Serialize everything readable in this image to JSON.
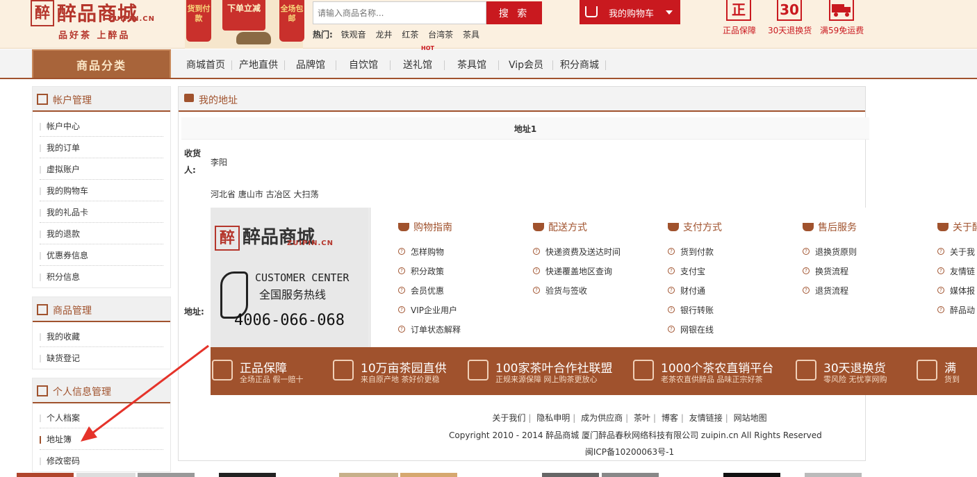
{
  "header": {
    "logo": {
      "seal": "醉",
      "name": "醉品商城",
      "domain": "ZUIPIN.CN",
      "slogan": "品好茶 上醉品"
    },
    "promo": {
      "left_lantern": "货到付款",
      "banner": "下单立减",
      "right_lantern": "全场包邮"
    },
    "search": {
      "placeholder": "请输入商品名称...",
      "button": "搜 索"
    },
    "hot": {
      "label": "热门:",
      "items": [
        "铁观音",
        "龙井",
        "红茶",
        "台湾茶",
        "茶具"
      ]
    },
    "cart": {
      "label": "我的购物车"
    },
    "guarantees": [
      {
        "icon": "正",
        "label": "正品保障"
      },
      {
        "icon": "30",
        "label": "30天退换货"
      },
      {
        "icon": "truck",
        "label": "满59免运费"
      }
    ]
  },
  "nav": {
    "category": "商品分类",
    "hot_badge": "HOT",
    "items": [
      "商城首页",
      "产地直供",
      "品牌馆",
      "自饮馆",
      "送礼馆",
      "茶具馆",
      "Vip会员",
      "积分商城"
    ]
  },
  "sidebar": {
    "groups": [
      {
        "title": "帐户管理",
        "items": [
          "帐户中心",
          "我的订单",
          "虚拟账户",
          "我的购物车",
          "我的礼品卡",
          "我的退款",
          "优惠券信息",
          "积分信息"
        ]
      },
      {
        "title": "商品管理",
        "items": [
          "我的收藏",
          "缺货登记"
        ]
      },
      {
        "title": "个人信息管理",
        "items": [
          "个人档案",
          "地址簿",
          "修改密码"
        ]
      }
    ]
  },
  "main": {
    "title": "我的地址",
    "address_title": "地址1",
    "receiver_label": "收货人:",
    "receiver": "李阳",
    "address_label": "地址:",
    "address": "河北省 唐山市 古冶区 大扫荡"
  },
  "footer": {
    "customer_center": {
      "seal": "醉",
      "name": "醉品商城",
      "domain": "ZUIPIN.CN",
      "en": "CUSTOMER CENTER",
      "hotline_label": "全国服务热线",
      "phone": "4006-066-068"
    },
    "columns": [
      {
        "title": "购物指南",
        "links": [
          "怎样购物",
          "积分政策",
          "会员优惠",
          "VIP企业用户",
          "订单状态解释"
        ]
      },
      {
        "title": "配送方式",
        "links": [
          "快递资费及送达时间",
          "快递覆盖地区查询",
          "验货与签收"
        ]
      },
      {
        "title": "支付方式",
        "links": [
          "货到付款",
          "支付宝",
          "财付通",
          "银行转账",
          "网银在线"
        ]
      },
      {
        "title": "售后服务",
        "links": [
          "退换货原则",
          "换货流程",
          "退货流程"
        ]
      },
      {
        "title": "关于醉",
        "links": [
          "关于我",
          "友情链",
          "媒体报",
          "醉品动"
        ]
      }
    ],
    "brand_bar": [
      {
        "title": "正品保障",
        "sub": "全场正品  假一赔十"
      },
      {
        "title": "10万亩茶园直供",
        "sub": "来自原产地  茶好价更稳"
      },
      {
        "title": "100家茶叶合作社联盟",
        "sub": "正规来源保障  网上购茶更放心"
      },
      {
        "title": "1000个茶农直销平台",
        "sub": "老茶农直供醉品  品味正宗好茶"
      },
      {
        "title": "30天退换货",
        "sub": "零风险  无忧享网购"
      },
      {
        "title": "满",
        "sub": "货到"
      }
    ],
    "links": [
      "关于我们",
      "隐私申明",
      "成为供应商",
      "茶叶",
      "博客",
      "友情链接",
      "网站地图"
    ],
    "copyright": "Copyright 2010 - 2014 醉品商城 厦门醉品春秋网络科技有限公司 zuipin.cn All Rights Reserved",
    "icp": "闽ICP备10200063号-1"
  },
  "colors": {
    "brand": "#a0522d",
    "red": "#c9191f",
    "header_bg": "#fbf0e0"
  }
}
